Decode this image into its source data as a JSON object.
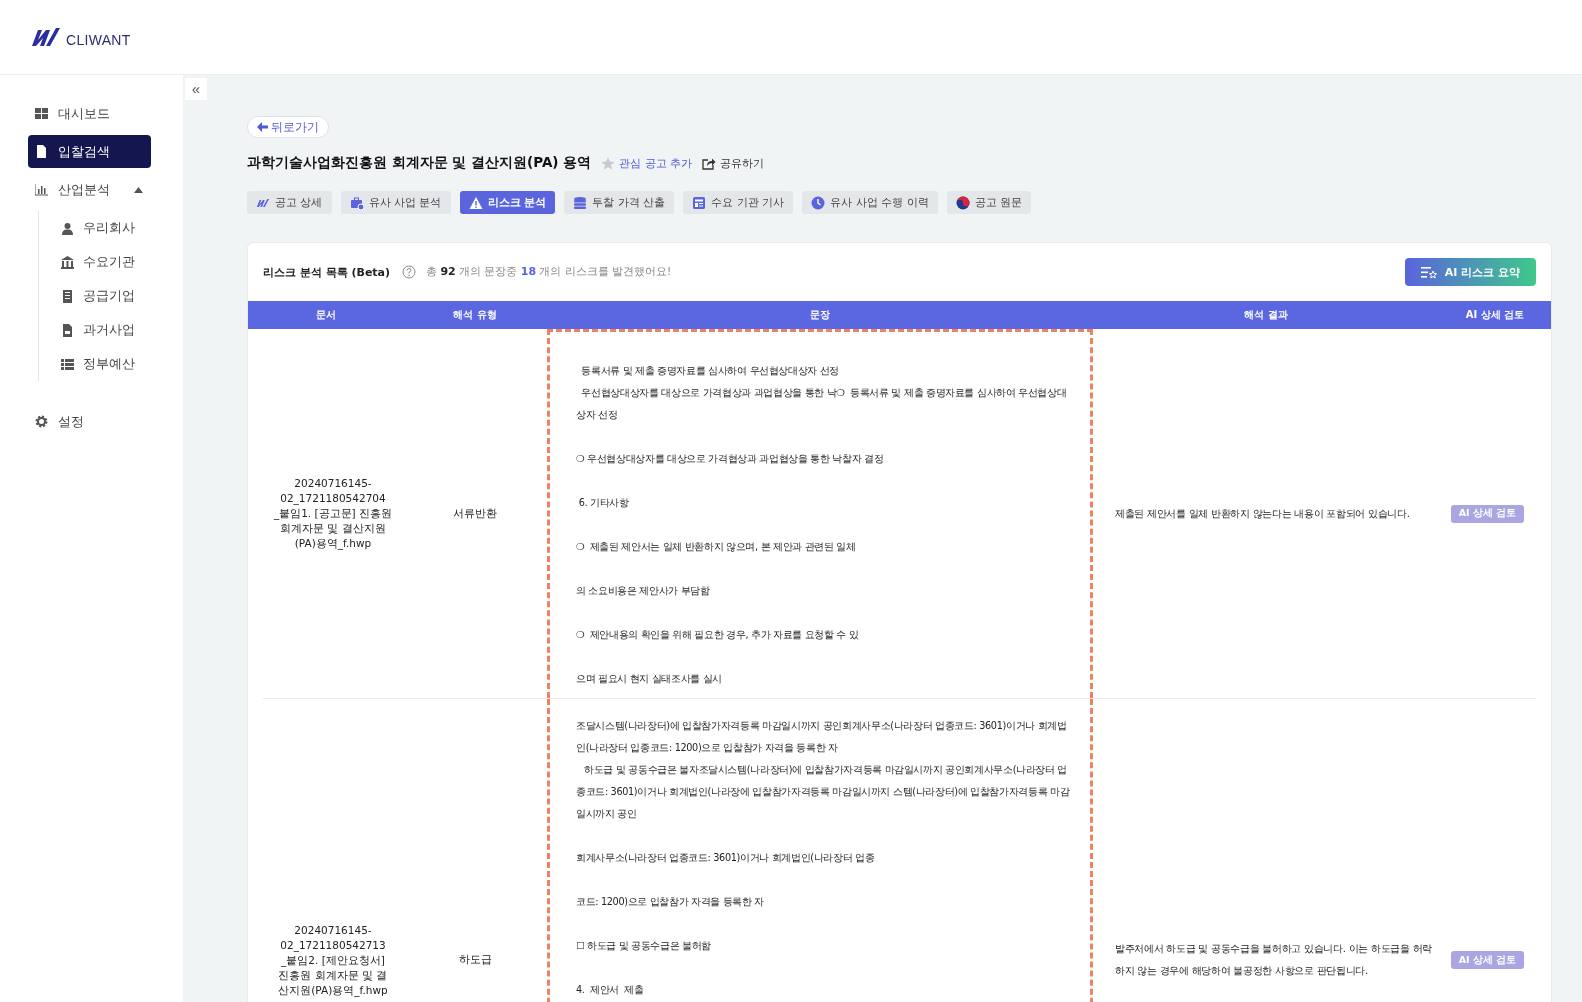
{
  "brand": {
    "name": "CLIWANT"
  },
  "sidebar": {
    "items": [
      {
        "label": "대시보드",
        "kind": "grid",
        "selected": false
      },
      {
        "label": "입찰검색",
        "kind": "doc",
        "selected": true
      },
      {
        "label": "산업분석",
        "kind": "chart",
        "selected": false,
        "expanded": true,
        "children": [
          {
            "label": "우리회사",
            "kind": "person",
            "selected": false
          },
          {
            "label": "수요기관",
            "kind": "bank",
            "selected": false
          },
          {
            "label": "공급기업",
            "kind": "building",
            "selected": false
          },
          {
            "label": "과거사업",
            "kind": "file",
            "selected": false
          },
          {
            "label": "정부예산",
            "kind": "list",
            "selected": false
          }
        ]
      },
      {
        "label": "설정",
        "kind": "gear",
        "selected": false
      }
    ]
  },
  "collapse_button": {
    "label": "«"
  },
  "back_button": {
    "label": "뒤로가기"
  },
  "title": "과학기술사업화진흥원 회계자문 및 결산지원(PA) 용역",
  "actions": [
    {
      "label": "관심 공고 추가",
      "kind": "star",
      "on": false
    },
    {
      "label": "공유하기",
      "kind": "share"
    }
  ],
  "tabs": [
    {
      "label": "공고 상세",
      "kind": "logo",
      "selected": false
    },
    {
      "label": "유사 사업 분석",
      "kind": "briefcase",
      "selected": false
    },
    {
      "label": "리스크 분석",
      "kind": "warning",
      "selected": true
    },
    {
      "label": "투찰 가격 산출",
      "kind": "coins",
      "selected": false
    },
    {
      "label": "수요 기관 기사",
      "kind": "news",
      "selected": false
    },
    {
      "label": "유사 사업 수행 이력",
      "kind": "clock",
      "selected": false
    },
    {
      "label": "공고 원문",
      "kind": "flag",
      "selected": false
    }
  ],
  "panel": {
    "title": "리스크 분석 목록 (Beta)",
    "summary": [
      {
        "text": "총 ",
        "kind": "plain"
      },
      {
        "text": "92",
        "kind": "count"
      },
      {
        "text": " 개의 문장중 ",
        "kind": "plain"
      },
      {
        "text": "18",
        "kind": "risk"
      },
      {
        "text": " 개의 리스크를 발견했어요!",
        "kind": "plain"
      }
    ],
    "summary_button": {
      "label": "AI 리스크 요약"
    }
  },
  "table": {
    "columns": [
      "문서",
      "해석 유형",
      "문장",
      "해석 결과",
      "AI 상세 검토"
    ],
    "rows": [
      {
        "document": [
          "20240716145-",
          "02_1721180542704",
          "_붙임1. [공고문] 진흥원",
          "회계자문 및 결산지원",
          "(PA)용역_f.hwp"
        ],
        "type": "서류반환",
        "sentence": [
          [
            "  등록서류 및 제출 증명자료를 심사하여 우선협상대상자 선정",
            "  우선협상대상자를 대상으로 가격협상과 과업협상을 통한 낙❍  등록서류 및 제출 증명자료를 심사하여 우선협상대",
            "상자 선정"
          ],
          [
            "❍ 우선협상대상자를 대상으로 가격협상과 과업협상을 통한 낙찰자 결정"
          ],
          [
            " 6. 기타사항"
          ],
          [
            "❍  제출된 제안서는 일체 반환하지 않으며, 본 제안과 관련된 일체"
          ],
          [
            "의 소요비용은 제안사가 부담함"
          ],
          [
            "❍  제안내용의 확인을 위해 필요한 경우, 추가 자료를 요청할 수 있"
          ],
          [
            "으며 필요시 현지 실태조사를 실시"
          ]
        ],
        "result": "제출된 제안서를 일체 반환하지 않는다는 내용이 포함되어 있습니다.",
        "action": "AI 상세 검토"
      },
      {
        "document": [
          "20240716145-",
          "02_1721180542713",
          "_붙임2. [제안요청서]",
          "진흥원 회계자문 및 결",
          "산지원(PA)용역_f.hwp"
        ],
        "type": "하도급",
        "sentence": [
          [
            "조달시스템(나라장터)에 입찰참가자격등록 마감일시까지 공인회계사무소(나라장터 업종코드: 3601)이거나 회계법",
            "인(나라장터 입종코드: 1200)으로 입찰참가 자격을 등록한 자",
            "   하도급 및 공동수급은 불자조달시스템(나라장터)에 입찰참가자격등록 마감일시까지 공인회계사무소(나라장터 업",
            "종코드: 3601)이거나 회계법인(나라장에 입찰참가자격등록 마감일시까지 스템(나라장터)에 입찰참가자격등록 마감",
            "일시까지 공인"
          ],
          [
            "회계사무소(나라장터 업종코드: 3601)이거나 회계법인(나라장터 업종"
          ],
          [
            "코드: 1200)으로 입찰참가 자격을 등록한 자"
          ],
          [
            "☐ 하도급 및 공동수급은 불허함"
          ],
          [
            "4.  제안서  제출"
          ]
        ],
        "result": "발주처에서 하도급 및 공동수급을 불허하고 있습니다. 이는 하도급을 허락하지 않는 경우에 해당하여 불공정한 사항으로 판단됩니다.",
        "action": "AI 상세 검토"
      }
    ]
  }
}
